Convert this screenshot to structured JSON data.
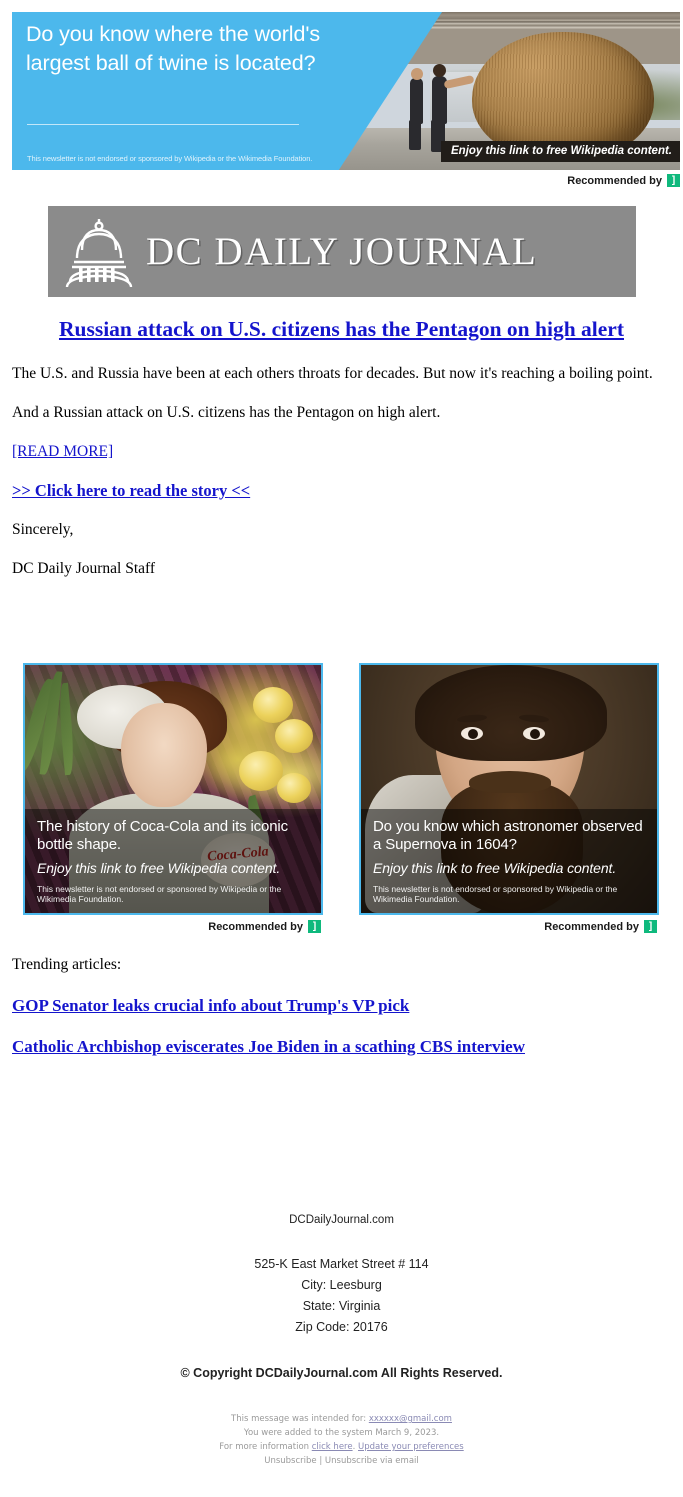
{
  "top_ad": {
    "headline": "Do you know where the world's largest ball of twine is located?",
    "disclaimer": "This newsletter is not endorsed or sponsored by Wikipedia or the Wikimedia Foundation.",
    "enjoy_strip": "Enjoy this link to free Wikipedia content.",
    "recommended_by": "Recommended by",
    "logo_glyph": "]",
    "accent_blue": "#4cb8ec",
    "logo_green": "#0fb97d"
  },
  "masthead": {
    "title": "DC DAILY JOURNAL",
    "background": "#8b8b8b",
    "icon": "capitol-dome-icon"
  },
  "article": {
    "headline": "Russian attack on U.S. citizens has the Pentagon on high alert",
    "paragraph_1": "The U.S. and Russia have been at each others throats for decades. But now it's reaching a boiling point.",
    "paragraph_2": "And a Russian attack on U.S. citizens has the Pentagon on high alert.",
    "read_more": "[READ MORE]",
    "click_here": ">> Click here to read the story <<",
    "signoff": "Sincerely,",
    "signature": "DC Daily Journal Staff",
    "link_color": "#1414cc"
  },
  "ad_cards": [
    {
      "title": "The history of Coca-Cola and its iconic bottle shape.",
      "subtitle": "Enjoy this link to free Wikipedia content.",
      "disclaimer": "This newsletter is not endorsed or sponsored by Wikipedia or the Wikimedia Foundation.",
      "recommended_by": "Recommended by",
      "logo_glyph": "]",
      "image_alt": "vintage-coca-cola-advertisement-woman",
      "brand_script": "Coca-Cola"
    },
    {
      "title": "Do you know which astronomer observed a Supernova in 1604?",
      "subtitle": "Enjoy this link to free Wikipedia content.",
      "disclaimer": "This newsletter is not endorsed or sponsored by Wikipedia or the Wikimedia Foundation.",
      "recommended_by": "Recommended by",
      "logo_glyph": "]",
      "image_alt": "portrait-of-johannes-kepler-astronomer"
    }
  ],
  "trending": {
    "label": "Trending articles:",
    "links": [
      "GOP Senator leaks crucial info about Trump's VP pick",
      "Catholic Archbishop eviscerates Joe Biden in a scathing CBS interview"
    ]
  },
  "footer": {
    "site": "DCDailyJournal.com",
    "address_line": "525-K East Market Street # 114",
    "city_line": "City: Leesburg",
    "state_line": "State: Virginia",
    "zip_line": "Zip Code: 20176",
    "copyright": "© Copyright DCDailyJournal.com All Rights Reserved."
  },
  "legal": {
    "intended_prefix": "This message was intended for: ",
    "intended_email": "xxxxxx@gmail.com",
    "added_line": "You were added to the system March 9, 2023.",
    "more_info_prefix": "For more information ",
    "click_here": "click here",
    "more_info_mid": ". ",
    "update_prefs": "Update your preferences",
    "unsubscribe_line": "Unsubscribe | Unsubscribe via email"
  }
}
